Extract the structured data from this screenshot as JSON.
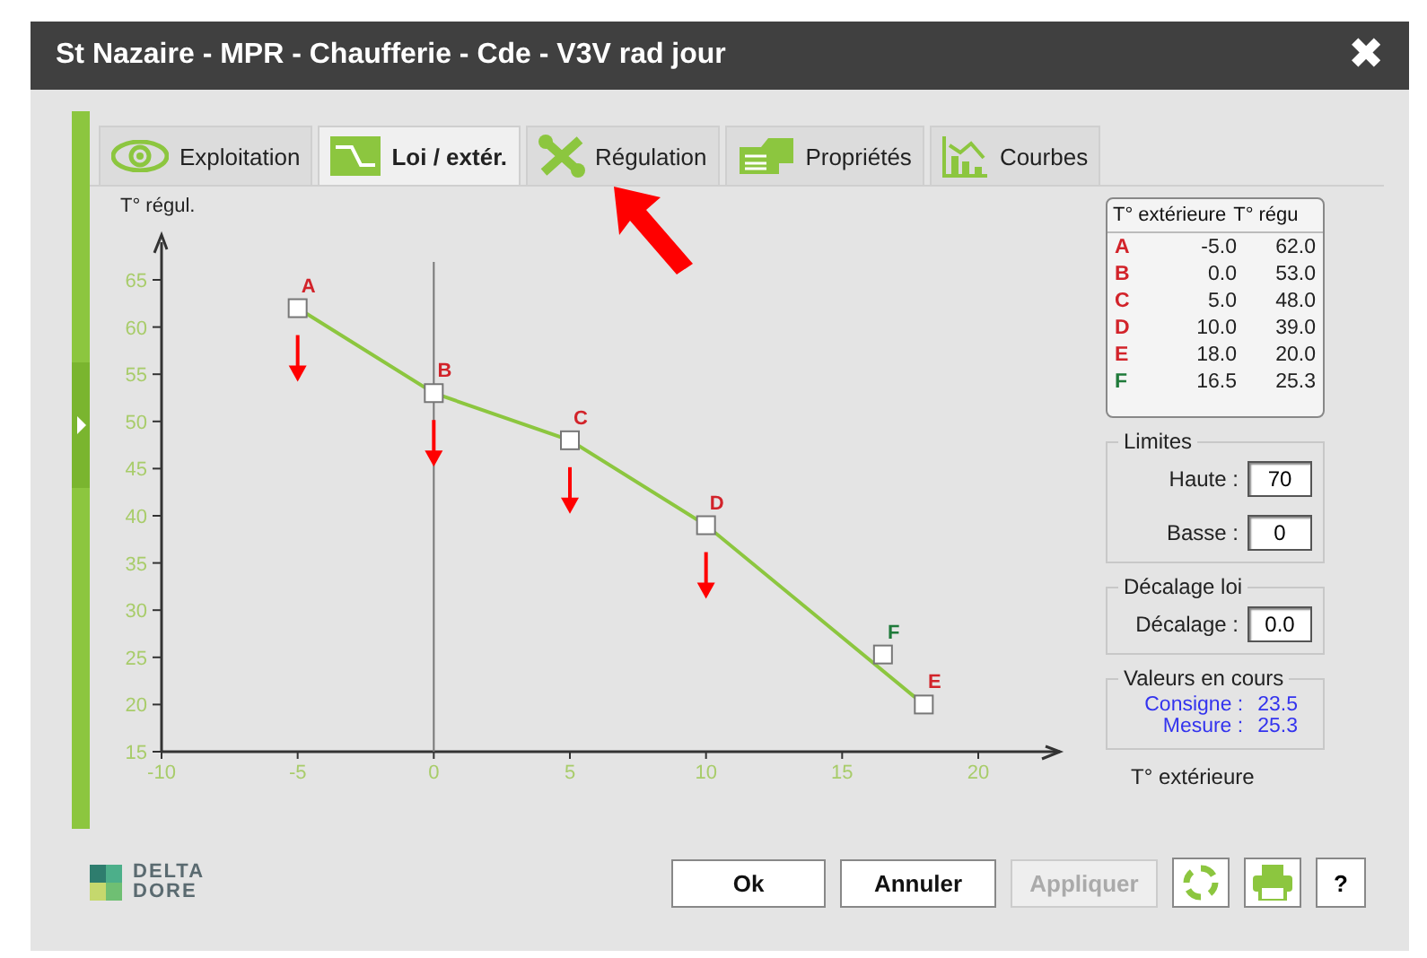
{
  "window": {
    "title": "St Nazaire - MPR - Chaufferie - Cde - V3V rad jour",
    "close": "✖"
  },
  "tabs": [
    {
      "label": "Exploitation",
      "kind": "eye",
      "selected": false
    },
    {
      "label": "Loi / extér.",
      "kind": "curve",
      "selected": true
    },
    {
      "label": "Régulation",
      "kind": "tools",
      "selected": false
    },
    {
      "label": "Propriétés",
      "kind": "card",
      "selected": false
    },
    {
      "label": "Courbes",
      "kind": "chart",
      "selected": false
    }
  ],
  "chart_data": {
    "type": "line",
    "ylabel": "T° régul.",
    "xlabel": "T° extérieure",
    "x": [
      -5,
      0,
      5,
      10,
      18
    ],
    "series": [
      {
        "color": "#8cc63f",
        "marker": "square",
        "values": [
          62,
          53,
          48,
          39,
          20
        ]
      }
    ],
    "xlim": [
      -10,
      23
    ],
    "ylim": [
      15,
      69
    ],
    "xticks": [
      -10,
      -5,
      0,
      5,
      10,
      15,
      20
    ],
    "yticks": [
      15,
      20,
      25,
      30,
      35,
      40,
      45,
      50,
      55,
      60,
      65
    ],
    "annotations": [
      {
        "x": -5,
        "y": 62,
        "text": "A"
      },
      {
        "x": 0,
        "y": 53,
        "text": "B"
      },
      {
        "x": 5,
        "y": 48,
        "text": "C"
      },
      {
        "x": 10,
        "y": 39,
        "text": "D"
      },
      {
        "x": 18,
        "y": 20,
        "text": "E"
      },
      {
        "x": 16.5,
        "y": 25.3,
        "text": "F"
      }
    ]
  },
  "down_arrows": [
    true,
    true,
    true,
    true,
    false,
    false
  ],
  "table": {
    "columns": [
      "T° extérieure",
      "T° régu"
    ],
    "rows": [
      {
        "point": "A",
        "color": "#d2232a",
        "ext": "-5.0",
        "reg": "62.0"
      },
      {
        "point": "B",
        "color": "#d2232a",
        "ext": "0.0",
        "reg": "53.0"
      },
      {
        "point": "C",
        "color": "#d2232a",
        "ext": "5.0",
        "reg": "48.0"
      },
      {
        "point": "D",
        "color": "#d2232a",
        "ext": "10.0",
        "reg": "39.0"
      },
      {
        "point": "E",
        "color": "#d2232a",
        "ext": "18.0",
        "reg": "20.0"
      },
      {
        "point": "F",
        "color": "#1f7a3a",
        "ext": "16.5",
        "reg": "25.3"
      }
    ]
  },
  "limits": {
    "title": "Limites",
    "fields": [
      {
        "label": "Haute :",
        "value": "70"
      },
      {
        "label": "Basse :",
        "value": "0"
      }
    ]
  },
  "offset": {
    "title": "Décalage loi",
    "fields": [
      {
        "label": "Décalage :",
        "value": "0.0"
      }
    ]
  },
  "current": {
    "title": "Valeurs en cours",
    "items": [
      {
        "label": "Consigne :",
        "value": "23.5"
      },
      {
        "label": "Mesure :",
        "value": "25.3"
      }
    ]
  },
  "logo": {
    "line1": "DELTA",
    "line2": "DORE"
  },
  "buttons": [
    {
      "label": "Ok",
      "disabled": false
    },
    {
      "label": "Annuler",
      "disabled": false
    },
    {
      "label": "Appliquer",
      "disabled": true
    }
  ],
  "help": "?"
}
